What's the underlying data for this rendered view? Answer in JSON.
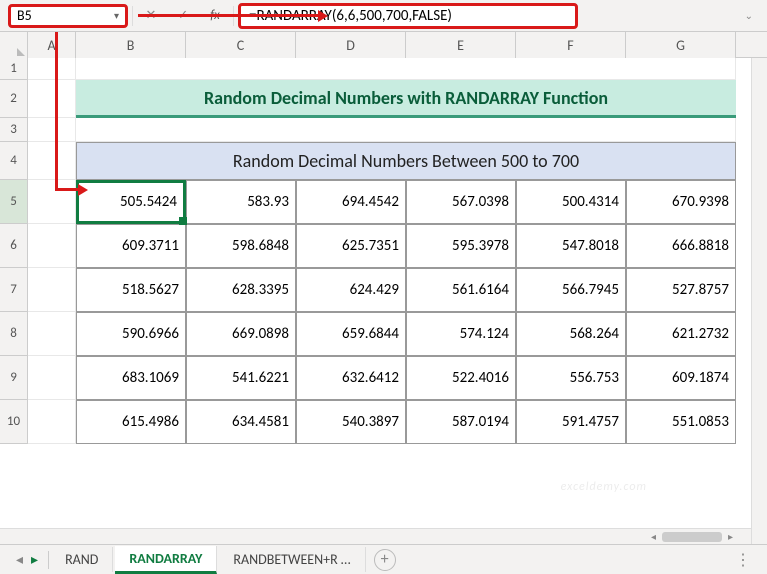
{
  "name_box": "B5",
  "formula": "=RANDARRAY(6,6,500,700,FALSE)",
  "fx_label": "fx",
  "columns": [
    "A",
    "B",
    "C",
    "D",
    "E",
    "F",
    "G"
  ],
  "rows": [
    "1",
    "2",
    "3",
    "4",
    "5",
    "6",
    "7",
    "8",
    "9",
    "10"
  ],
  "banner": "Random Decimal Numbers with RANDARRAY Function",
  "subtitle": "Random Decimal Numbers Between 500 to 700",
  "data": [
    [
      "505.5424",
      "583.93",
      "694.4542",
      "567.0398",
      "500.4314",
      "670.9398"
    ],
    [
      "609.3711",
      "598.6848",
      "625.7351",
      "595.3978",
      "547.8018",
      "666.8818"
    ],
    [
      "518.5627",
      "628.3395",
      "624.429",
      "561.6164",
      "566.7945",
      "527.8757"
    ],
    [
      "590.6966",
      "669.0898",
      "659.6844",
      "574.124",
      "568.264",
      "621.2732"
    ],
    [
      "683.1069",
      "541.6221",
      "632.6412",
      "522.4016",
      "556.753",
      "609.1874"
    ],
    [
      "615.4986",
      "634.4581",
      "540.3897",
      "587.0194",
      "591.4757",
      "551.0853"
    ]
  ],
  "tabs": {
    "nav_prev": "◂",
    "nav_next": "▸",
    "items": [
      "RAND",
      "RANDARRAY",
      "RANDBETWEEN+R …"
    ],
    "active_index": 1,
    "add": "+",
    "menu": "⋮"
  },
  "watermark": "exceldemy.com"
}
